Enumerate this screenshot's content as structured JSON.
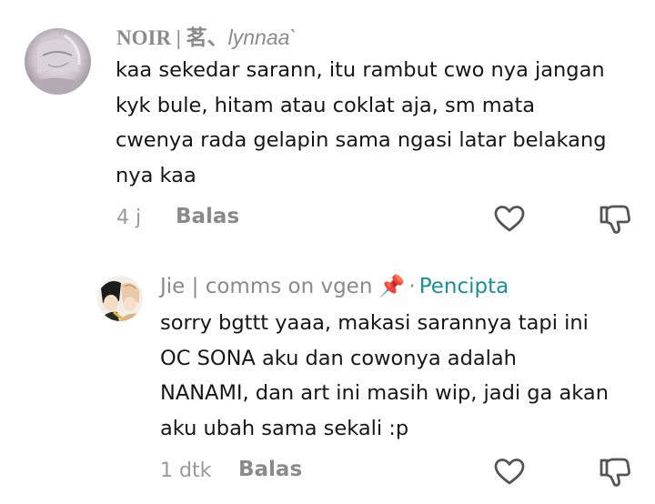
{
  "comments": [
    {
      "author_name": "NOIR | 茗、",
      "author_handle": "lynnaa`",
      "text": "kaa sekedar sarann, itu rambut cwo nya jangan\nkyk bule, hitam atau coklat aja, sm mata\ncwenya rada gelapin sama ngasi latar belakang\nnya kaa",
      "time": "4 j",
      "reply_label": "Balas",
      "like_icon": "heart-outline",
      "dislike_icon": "thumbs-down-outline"
    },
    {
      "author_name": "Jie | comms on vgen",
      "author_pin": "📌",
      "separator": "·",
      "creator_badge": "Pencipta",
      "text": "sorry bgttt yaaa, makasi sarannya tapi ini\nOC SONA aku dan cowonya adalah\nNANAMI, dan art ini masih wip, jadi ga akan\naku ubah sama sekali :p",
      "time": "1 dtk",
      "reply_label": "Balas",
      "like_icon": "heart-outline",
      "dislike_icon": "thumbs-down-outline"
    }
  ],
  "colors": {
    "text": "#161616",
    "meta": "#9a9a9a",
    "creator_badge": "#1a8f96",
    "icon_stroke": "#555555"
  }
}
